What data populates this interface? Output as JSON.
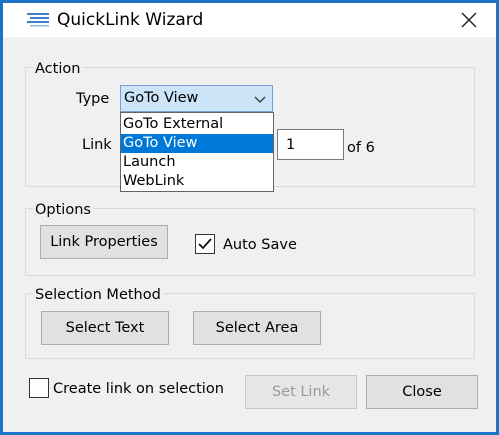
{
  "window": {
    "title": "QuickLink Wizard"
  },
  "action": {
    "group_label": "Action",
    "type_label": "Type",
    "type_value": "GoTo View",
    "type_options": [
      "GoTo External",
      "GoTo View",
      "Launch",
      "WebLink"
    ],
    "selected_index": 1,
    "link_label": "Link",
    "page_value": "1",
    "page_of": "of 6"
  },
  "options": {
    "group_label": "Options",
    "link_properties_label": "Link Properties",
    "auto_save_label": "Auto Save",
    "auto_save_checked": true
  },
  "selection": {
    "group_label": "Selection Method",
    "select_text_label": "Select Text",
    "select_area_label": "Select Area"
  },
  "footer": {
    "create_link_label": "Create link on selection",
    "create_link_checked": false,
    "set_link_label": "Set Link",
    "close_label": "Close"
  }
}
